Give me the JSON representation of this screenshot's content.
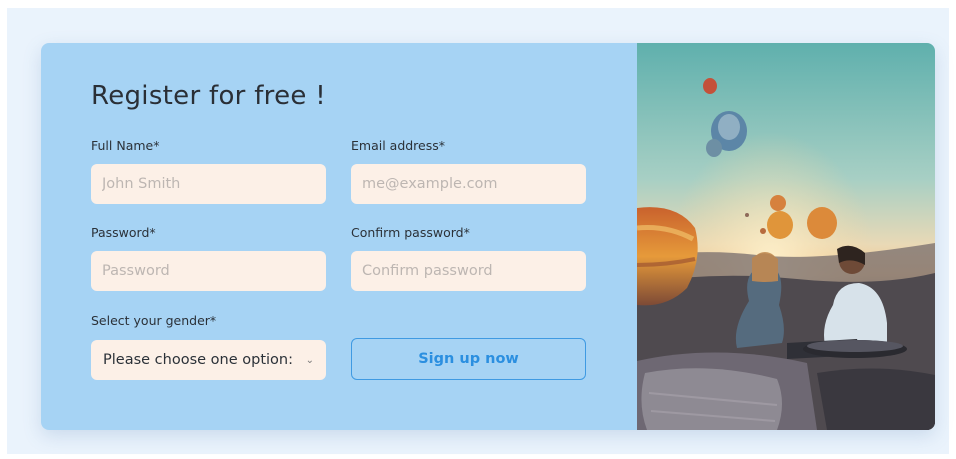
{
  "form": {
    "title": "Register for free !",
    "full_name": {
      "label": "Full Name*",
      "placeholder": "John Smith"
    },
    "email": {
      "label": "Email address*",
      "placeholder": "me@example.com"
    },
    "password": {
      "label": "Password*",
      "placeholder": "Password"
    },
    "confirm_password": {
      "label": "Confirm password*",
      "placeholder": "Confirm password"
    },
    "gender": {
      "label": "Select your gender*",
      "selected": "Please choose one option:",
      "icon": "chevron-down-icon"
    },
    "submit_label": "Sign up now"
  },
  "colors": {
    "form_background": "#a6d3f4",
    "input_background": "#fcf0e7",
    "button_accent": "#3f9ae2"
  }
}
